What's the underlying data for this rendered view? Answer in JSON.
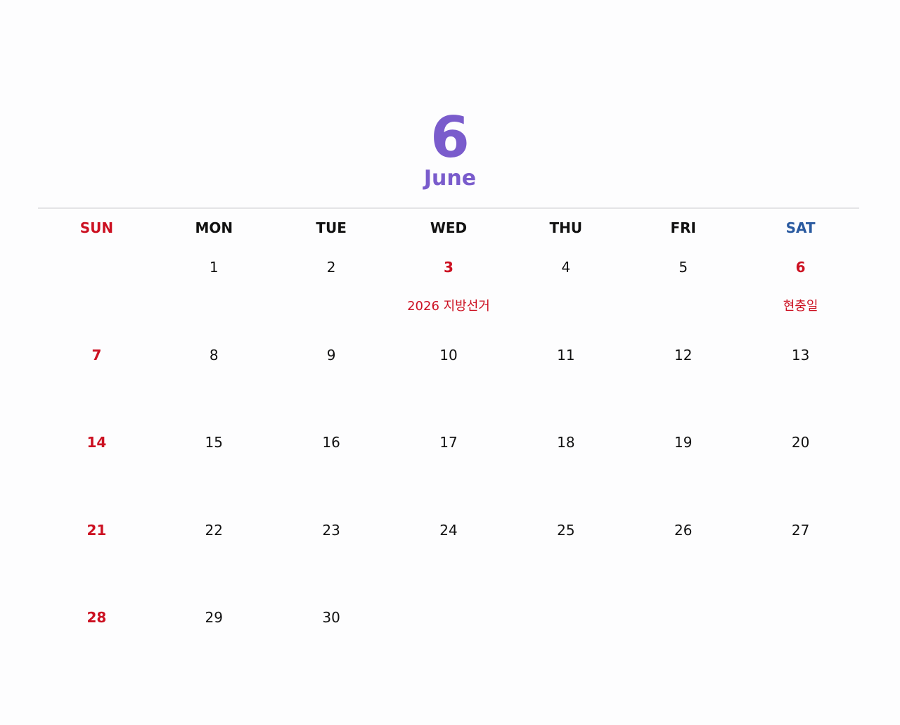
{
  "header": {
    "month_number": "6",
    "month_name": "June"
  },
  "weekdays": [
    "SUN",
    "MON",
    "TUE",
    "WED",
    "THU",
    "FRI",
    "SAT"
  ],
  "weeks": [
    [
      {
        "day": "",
        "event": ""
      },
      {
        "day": "1",
        "event": ""
      },
      {
        "day": "2",
        "event": ""
      },
      {
        "day": "3",
        "event": "2026 지방선거",
        "holiday": true
      },
      {
        "day": "4",
        "event": ""
      },
      {
        "day": "5",
        "event": ""
      },
      {
        "day": "6",
        "event": "현충일",
        "holiday": true
      }
    ],
    [
      {
        "day": "7",
        "event": ""
      },
      {
        "day": "8",
        "event": ""
      },
      {
        "day": "9",
        "event": ""
      },
      {
        "day": "10",
        "event": ""
      },
      {
        "day": "11",
        "event": ""
      },
      {
        "day": "12",
        "event": ""
      },
      {
        "day": "13",
        "event": ""
      }
    ],
    [
      {
        "day": "14",
        "event": ""
      },
      {
        "day": "15",
        "event": ""
      },
      {
        "day": "16",
        "event": ""
      },
      {
        "day": "17",
        "event": ""
      },
      {
        "day": "18",
        "event": ""
      },
      {
        "day": "19",
        "event": ""
      },
      {
        "day": "20",
        "event": ""
      }
    ],
    [
      {
        "day": "21",
        "event": ""
      },
      {
        "day": "22",
        "event": ""
      },
      {
        "day": "23",
        "event": ""
      },
      {
        "day": "24",
        "event": ""
      },
      {
        "day": "25",
        "event": ""
      },
      {
        "day": "26",
        "event": ""
      },
      {
        "day": "27",
        "event": ""
      }
    ],
    [
      {
        "day": "28",
        "event": ""
      },
      {
        "day": "29",
        "event": ""
      },
      {
        "day": "30",
        "event": ""
      },
      {
        "day": "",
        "event": ""
      },
      {
        "day": "",
        "event": ""
      },
      {
        "day": "",
        "event": ""
      },
      {
        "day": "",
        "event": ""
      }
    ]
  ],
  "colors": {
    "accent": "#7a5ccc",
    "sunday_holiday": "#cc1122",
    "saturday": "#2a5aa0",
    "text": "#111111",
    "rule": "#e4e4e6"
  }
}
